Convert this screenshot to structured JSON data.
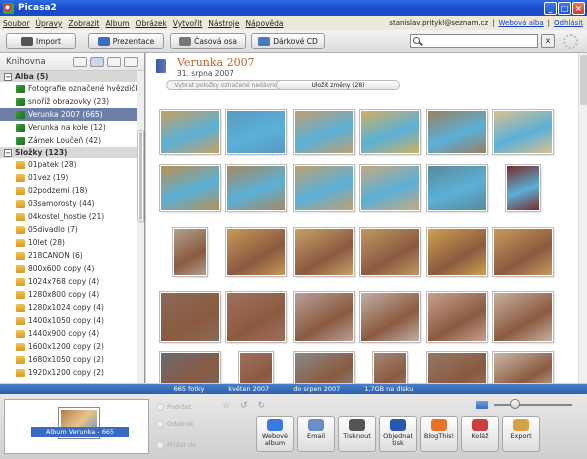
{
  "window": {
    "title": "Picasa2"
  },
  "menu": {
    "items": [
      "Soubor",
      "Úpravy",
      "Zobrazit",
      "Album",
      "Obrázek",
      "Vytvořit",
      "Nástroje",
      "Nápověda"
    ],
    "user": "stanislav.pritykl@seznam.cz",
    "web_albums": "Webová alba",
    "logout": "Odhlásit"
  },
  "toolbar": {
    "import": "Import",
    "slideshow": "Prezentace",
    "timeline": "Časová osa",
    "giftcd": "Dárkové CD",
    "search_placeholder": "",
    "clear": "x"
  },
  "library": {
    "title": "Knihovna",
    "albums_header": "Alba (5)",
    "albums": [
      {
        "label": "Fotografie označené hvězdičko...",
        "selected": false
      },
      {
        "label": "snoříž obrazovky (23)",
        "selected": false
      },
      {
        "label": "Verunka 2007 (665)",
        "selected": true
      },
      {
        "label": "Verunka na kole (12)",
        "selected": false
      },
      {
        "label": "Zámek Loučeň (42)",
        "selected": false
      }
    ],
    "folders_header": "Složky (123)",
    "folders": [
      "01patek (28)",
      "01vez (19)",
      "02podzemi (18)",
      "03samorosty (44)",
      "04kostel_hostie (21)",
      "05divadlo (7)",
      "10let (28)",
      "218CANON (6)",
      "800x600 copy (4)",
      "1024x768 copy (4)",
      "1280x800 copy (4)",
      "1280x1024 copy (4)",
      "1400x1050 copy (4)",
      "1440x900 copy (4)",
      "1600x1200 copy (2)",
      "1680x1050 copy (2)",
      "1920x1200 copy (2)"
    ]
  },
  "album": {
    "title": "Verunka 2007",
    "date": "31. srpna 2007",
    "pill_left": "Vybrat položky označené nedávno",
    "pill_right": "Uložit změny (28)"
  },
  "status": {
    "count": "665 fotky",
    "from": "květen 2007",
    "to": "do srpen 2007",
    "size": "1,7GB na disku"
  },
  "tray": {
    "caption": "Album Verunka - 665 fotografie",
    "hold": "Podržet",
    "clear": "Odebrat",
    "add_to": "Přidat do"
  },
  "actions": [
    {
      "label": "Webové album",
      "color": "#3b7be0"
    },
    {
      "label": "Email",
      "color": "#6a8ec8"
    },
    {
      "label": "Tisknout",
      "color": "#555555"
    },
    {
      "label": "Objednat tisk",
      "color": "#2a55b0"
    },
    {
      "label": "BlogThis!",
      "color": "#e8722a"
    },
    {
      "label": "Koláž",
      "color": "#c84040"
    },
    {
      "label": "Export",
      "color": "#d8a040"
    }
  ],
  "thumb_rows": [
    {
      "tones": [
        "#c8a060",
        "#5a9ac0",
        "#c0a070",
        "#d0b060",
        "#9a8060",
        "#d8c090"
      ]
    },
    {
      "tones": [
        "#b89050",
        "#a88860",
        "#c0a070",
        "#c8a880",
        "#5a8a9a",
        "#7a2a2a"
      ]
    },
    {
      "tones": [
        "#b0a090",
        "#c89858",
        "#c8a068",
        "#c09860",
        "#d0a050",
        "#c89a5a"
      ]
    },
    {
      "tones": [
        "#8a6a5a",
        "#a07060",
        "#b8a098",
        "#c0b0a8",
        "#c8a090",
        "#c8b0a0"
      ]
    },
    {
      "tones": [
        "#6a6a70",
        "#a07060",
        "#8a8a8a",
        "#a08878",
        "#907868",
        "#c8b8a8"
      ]
    }
  ]
}
